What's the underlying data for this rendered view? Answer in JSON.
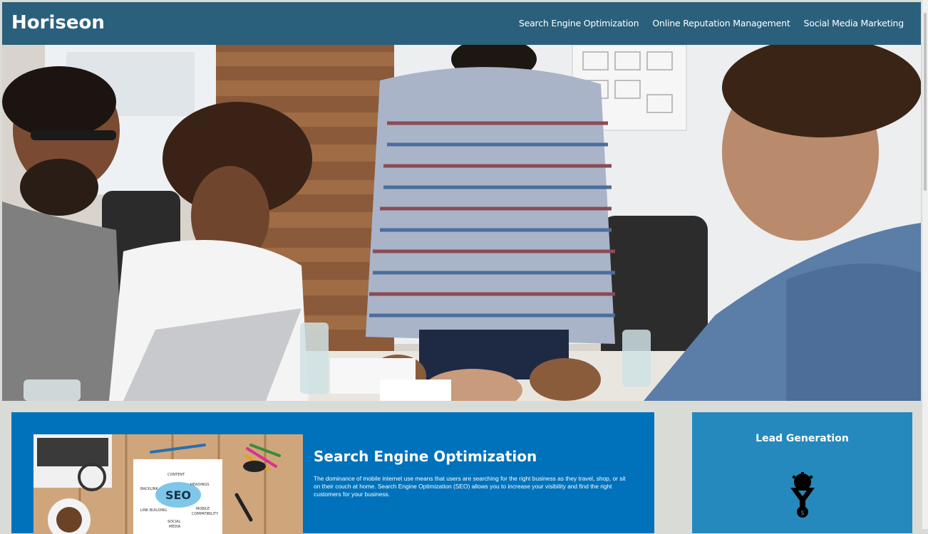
{
  "header": {
    "logo": "Horiseon",
    "nav": [
      "Search Engine Optimization",
      "Online Reputation Management",
      "Social Media Marketing"
    ]
  },
  "main": {
    "seo": {
      "title": "Search Engine Optimization",
      "body": "The dominance of mobile internet use means that users are searching for the right business as they travel, shop, or sit on their couch at home. Search Engine Optimization (SEO) allows you to increase your visibility and find the right customers for your business.",
      "image_text": {
        "center": "SEO",
        "content": "CONTENT",
        "backlink": "BACKLINK",
        "headings": "HEADINGS",
        "mobile": "MOBILE",
        "compat": "COMPATIBILITY",
        "link": "LINK BUILDING",
        "social": "SOCIAL",
        "media": "MEDIA"
      }
    }
  },
  "sidebar": {
    "title": "Lead Generation"
  },
  "colors": {
    "header": "#2a607c",
    "content": "#0072bb",
    "aside": "#2589bd",
    "page": "#d9dcd6"
  },
  "icons": [
    "lead-funnel-icon"
  ]
}
